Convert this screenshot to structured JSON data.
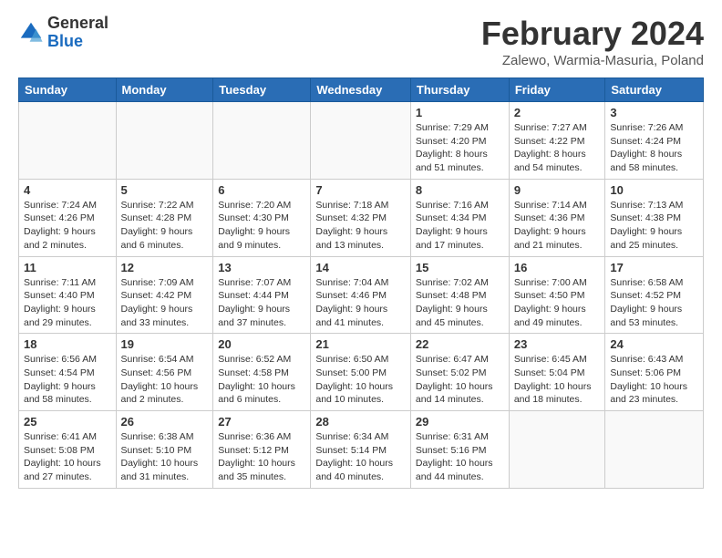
{
  "logo": {
    "general": "General",
    "blue": "Blue"
  },
  "title": "February 2024",
  "location": "Zalewo, Warmia-Masuria, Poland",
  "days": [
    "Sunday",
    "Monday",
    "Tuesday",
    "Wednesday",
    "Thursday",
    "Friday",
    "Saturday"
  ],
  "weeks": [
    [
      {
        "day": "",
        "info": ""
      },
      {
        "day": "",
        "info": ""
      },
      {
        "day": "",
        "info": ""
      },
      {
        "day": "",
        "info": ""
      },
      {
        "day": "1",
        "info": "Sunrise: 7:29 AM\nSunset: 4:20 PM\nDaylight: 8 hours\nand 51 minutes."
      },
      {
        "day": "2",
        "info": "Sunrise: 7:27 AM\nSunset: 4:22 PM\nDaylight: 8 hours\nand 54 minutes."
      },
      {
        "day": "3",
        "info": "Sunrise: 7:26 AM\nSunset: 4:24 PM\nDaylight: 8 hours\nand 58 minutes."
      }
    ],
    [
      {
        "day": "4",
        "info": "Sunrise: 7:24 AM\nSunset: 4:26 PM\nDaylight: 9 hours\nand 2 minutes."
      },
      {
        "day": "5",
        "info": "Sunrise: 7:22 AM\nSunset: 4:28 PM\nDaylight: 9 hours\nand 6 minutes."
      },
      {
        "day": "6",
        "info": "Sunrise: 7:20 AM\nSunset: 4:30 PM\nDaylight: 9 hours\nand 9 minutes."
      },
      {
        "day": "7",
        "info": "Sunrise: 7:18 AM\nSunset: 4:32 PM\nDaylight: 9 hours\nand 13 minutes."
      },
      {
        "day": "8",
        "info": "Sunrise: 7:16 AM\nSunset: 4:34 PM\nDaylight: 9 hours\nand 17 minutes."
      },
      {
        "day": "9",
        "info": "Sunrise: 7:14 AM\nSunset: 4:36 PM\nDaylight: 9 hours\nand 21 minutes."
      },
      {
        "day": "10",
        "info": "Sunrise: 7:13 AM\nSunset: 4:38 PM\nDaylight: 9 hours\nand 25 minutes."
      }
    ],
    [
      {
        "day": "11",
        "info": "Sunrise: 7:11 AM\nSunset: 4:40 PM\nDaylight: 9 hours\nand 29 minutes."
      },
      {
        "day": "12",
        "info": "Sunrise: 7:09 AM\nSunset: 4:42 PM\nDaylight: 9 hours\nand 33 minutes."
      },
      {
        "day": "13",
        "info": "Sunrise: 7:07 AM\nSunset: 4:44 PM\nDaylight: 9 hours\nand 37 minutes."
      },
      {
        "day": "14",
        "info": "Sunrise: 7:04 AM\nSunset: 4:46 PM\nDaylight: 9 hours\nand 41 minutes."
      },
      {
        "day": "15",
        "info": "Sunrise: 7:02 AM\nSunset: 4:48 PM\nDaylight: 9 hours\nand 45 minutes."
      },
      {
        "day": "16",
        "info": "Sunrise: 7:00 AM\nSunset: 4:50 PM\nDaylight: 9 hours\nand 49 minutes."
      },
      {
        "day": "17",
        "info": "Sunrise: 6:58 AM\nSunset: 4:52 PM\nDaylight: 9 hours\nand 53 minutes."
      }
    ],
    [
      {
        "day": "18",
        "info": "Sunrise: 6:56 AM\nSunset: 4:54 PM\nDaylight: 9 hours\nand 58 minutes."
      },
      {
        "day": "19",
        "info": "Sunrise: 6:54 AM\nSunset: 4:56 PM\nDaylight: 10 hours\nand 2 minutes."
      },
      {
        "day": "20",
        "info": "Sunrise: 6:52 AM\nSunset: 4:58 PM\nDaylight: 10 hours\nand 6 minutes."
      },
      {
        "day": "21",
        "info": "Sunrise: 6:50 AM\nSunset: 5:00 PM\nDaylight: 10 hours\nand 10 minutes."
      },
      {
        "day": "22",
        "info": "Sunrise: 6:47 AM\nSunset: 5:02 PM\nDaylight: 10 hours\nand 14 minutes."
      },
      {
        "day": "23",
        "info": "Sunrise: 6:45 AM\nSunset: 5:04 PM\nDaylight: 10 hours\nand 18 minutes."
      },
      {
        "day": "24",
        "info": "Sunrise: 6:43 AM\nSunset: 5:06 PM\nDaylight: 10 hours\nand 23 minutes."
      }
    ],
    [
      {
        "day": "25",
        "info": "Sunrise: 6:41 AM\nSunset: 5:08 PM\nDaylight: 10 hours\nand 27 minutes."
      },
      {
        "day": "26",
        "info": "Sunrise: 6:38 AM\nSunset: 5:10 PM\nDaylight: 10 hours\nand 31 minutes."
      },
      {
        "day": "27",
        "info": "Sunrise: 6:36 AM\nSunset: 5:12 PM\nDaylight: 10 hours\nand 35 minutes."
      },
      {
        "day": "28",
        "info": "Sunrise: 6:34 AM\nSunset: 5:14 PM\nDaylight: 10 hours\nand 40 minutes."
      },
      {
        "day": "29",
        "info": "Sunrise: 6:31 AM\nSunset: 5:16 PM\nDaylight: 10 hours\nand 44 minutes."
      },
      {
        "day": "",
        "info": ""
      },
      {
        "day": "",
        "info": ""
      }
    ]
  ]
}
